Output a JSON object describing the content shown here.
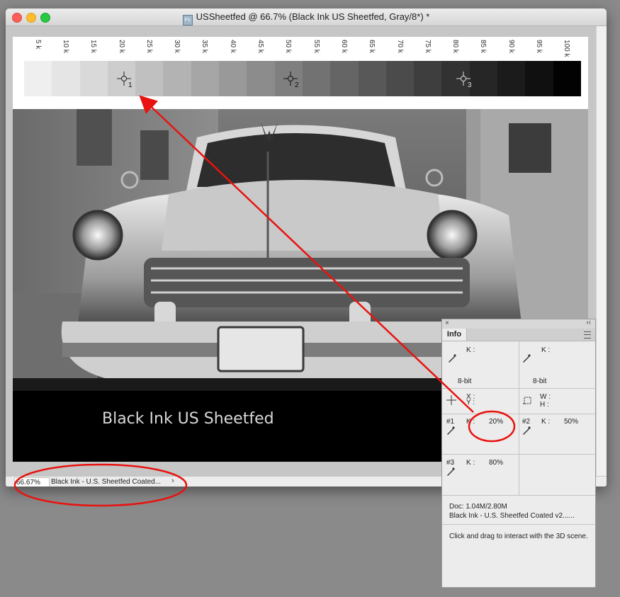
{
  "window": {
    "title": "USSheetfed @ 66.7% (Black Ink US Sheetfed, Gray/8*) *",
    "app_icon": "Ps"
  },
  "ruler": {
    "ticks": [
      "5 k",
      "10 k",
      "15 k",
      "20 k",
      "25 k",
      "30 k",
      "35 k",
      "40 k",
      "45 k",
      "50 k",
      "55 k",
      "60 k",
      "65 k",
      "70 k",
      "75 k",
      "80 k",
      "85 k",
      "90 k",
      "95 k",
      "100 k"
    ]
  },
  "gray_strip": {
    "swatch_colors": [
      "#efefef",
      "#e5e5e5",
      "#d9d9d9",
      "#cdcdcd",
      "#c0c0c0",
      "#b3b3b3",
      "#a6a6a6",
      "#999999",
      "#8c8c8c",
      "#7f7f7f",
      "#727272",
      "#656565",
      "#585858",
      "#4b4b4b",
      "#3e3e3e",
      "#323232",
      "#262626",
      "#1b1b1b",
      "#101010",
      "#020202"
    ]
  },
  "samplers": [
    {
      "label": "1"
    },
    {
      "label": "2"
    },
    {
      "label": "3"
    }
  ],
  "banner": {
    "text": "Black Ink US Sheetfed"
  },
  "statusbar": {
    "zoom": "66.67%",
    "profile": "Black Ink - U.S. Sheetfed Coated...",
    "chevron": "›"
  },
  "info_panel": {
    "tab": "Info",
    "close": "×",
    "collapse": "‹‹",
    "left_k": "K :",
    "right_k": "K :",
    "left_depth": "8-bit",
    "right_depth": "8-bit",
    "x_label": "X :",
    "y_label": "Y :",
    "w_label": "W :",
    "h_label": "H :",
    "s1_id": "#1",
    "s1_k": "K :",
    "s1_val": "20%",
    "s2_id": "#2",
    "s2_k": "K :",
    "s2_val": "50%",
    "s3_id": "#3",
    "s3_k": "K :",
    "s3_val": "80%",
    "doc_size": "Doc: 1.04M/2.80M",
    "doc_profile": "Black Ink - U.S. Sheetfed Coated v2......",
    "hint": "Click and drag to interact with the 3D scene."
  },
  "annotation_color": "#e8130f"
}
